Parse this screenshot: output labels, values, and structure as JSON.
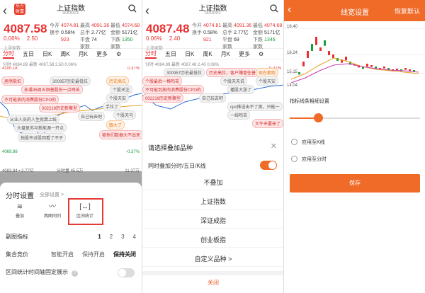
{
  "left_panel": {
    "header": {
      "title": "上证指数",
      "code": "000001",
      "logo_text": "东方财富"
    },
    "quote": {
      "price": "4087.58",
      "change_pct": "0.06%",
      "change": "2.50",
      "rows": [
        [
          {
            "l": "今开",
            "v": "4074.81",
            "c": "red"
          },
          {
            "l": "最高",
            "v": "4091.36",
            "c": "red"
          },
          {
            "l": "最低",
            "v": "4074.68",
            "c": "red"
          }
        ],
        [
          {
            "l": "换手",
            "v": "0.58%",
            "c": ""
          },
          {
            "l": "总手",
            "v": "2.77亿",
            "c": ""
          },
          {
            "l": "金额",
            "v": "5171亿",
            "c": ""
          }
        ],
        [
          {
            "l": "",
            "v": "923",
            "c": "red"
          },
          {
            "l": "平盘家数",
            "v": "74",
            "c": ""
          },
          {
            "l": "下跌家数",
            "v": "1350",
            "c": "grn"
          }
        ]
      ],
      "sub_labels": "上涨家数"
    },
    "tabs": [
      "分时",
      "五日",
      "日K",
      "周K",
      "月K",
      "更多"
    ],
    "indicator": "分时 4084.89  最新 4087.58  2.50  0.06%",
    "chart": {
      "top_left": "4100.18",
      "top_right": "0.37%",
      "bottom_left": "4069.98",
      "bottom_right": "-0.37%",
      "annotations": [
        "居然能扣",
        "300957历史最低位",
        "历史高位",
        "永凝45周五铜普股份一点鸣苦",
        "个股关注",
        "个股天安",
        "不可能放肉消费股份CPO的",
        "手拉了",
        "002219历史新聚型",
        "自己玩去吧",
        "个股天马",
        "跟大了",
        "从业人员的人生就算上线",
        "大盘复苏与新能源一开点",
        "独股市对股回看了不于",
        "被他们数据大不出来"
      ],
      "vol_left": "4083.94 • 2.77亿",
      "vol_mid": "分时量 45.5万",
      "vol_right": "11.37万"
    },
    "sheet": {
      "title": "分时设置",
      "all_settings": "全部设置 >",
      "icons": [
        {
          "label": "叠加",
          "icon": "layers-icon"
        },
        {
          "label": "两图同列",
          "icon": "dual-chart-icon"
        },
        {
          "label": "区间统计",
          "icon": "range-stats-icon"
        }
      ],
      "sub_indicator_label": "副图指标",
      "sub_indicator_opts": [
        "1",
        "2",
        "3",
        "4"
      ],
      "sub_indicator_selected": "1",
      "auction_label": "集合竞价",
      "auction_opts": [
        "智能开启",
        "保持开启",
        "保持关闭"
      ],
      "auction_selected": "保持关闭",
      "range_axis_label": "区间统计时间轴固定展示",
      "help_icon": "help-icon"
    }
  },
  "middle_panel": {
    "header": {
      "title": "上证指数",
      "code": "000001"
    },
    "quote": {
      "price": "4087.48",
      "change_pct": "0.06%",
      "change": "2.40",
      "rows": [
        [
          {
            "l": "今开",
            "v": "4074.81",
            "c": "red"
          },
          {
            "l": "最高",
            "v": "4091.36",
            "c": "red"
          },
          {
            "l": "最低",
            "v": "4074.68",
            "c": "red"
          }
        ],
        [
          {
            "l": "换手",
            "v": "0.58%",
            "c": ""
          },
          {
            "l": "总手",
            "v": "2.77亿",
            "c": ""
          },
          {
            "l": "金额",
            "v": "5171亿",
            "c": ""
          }
        ],
        [
          {
            "l": "",
            "v": "921",
            "c": "red"
          },
          {
            "l": "平盘家数",
            "v": "69",
            "c": ""
          },
          {
            "l": "下跌家数",
            "v": "1346",
            "c": "grn"
          }
        ]
      ],
      "sub_labels": "上涨家数"
    },
    "tabs": [
      "分时",
      "五日",
      "日K",
      "周K",
      "月K",
      "更多"
    ],
    "indicator": "分时 4084.89  最新 4087.48  2.40  0.06%",
    "chart": {
      "top_right": "0.37%",
      "annotations": [
        "300957历史最低位",
        "历史高位，客户赚冒往普",
        "现在都跑",
        "个股最后一格鸣苦",
        "个股天天说",
        "个股天安",
        "不可能到放肉消费股份CPO的",
        "播股大涨了",
        "002219历史新聚型",
        "自己玩去吧",
        "cpo推送出不了类，只能一",
        "一线鸣苦",
        "大牛市要来了"
      ]
    },
    "sheet": {
      "title": "请选择叠加品种",
      "toggle_label": "同时叠加分时/五日/K线",
      "options": [
        "不叠加",
        "上证指数",
        "深证成指",
        "创业板指",
        "自定义品种 >"
      ],
      "close": "关闭"
    }
  },
  "right_panel": {
    "header": {
      "title": "线宽设置",
      "reset": "恢复默认"
    },
    "chart_ticks": [
      "18.40",
      "16.24",
      "15.15",
      "14.04"
    ],
    "slider_label": "指标线条粗细设置",
    "slider_value": 0.22,
    "radios": [
      "应用至K线",
      "应用至分时"
    ],
    "save": "保存"
  }
}
